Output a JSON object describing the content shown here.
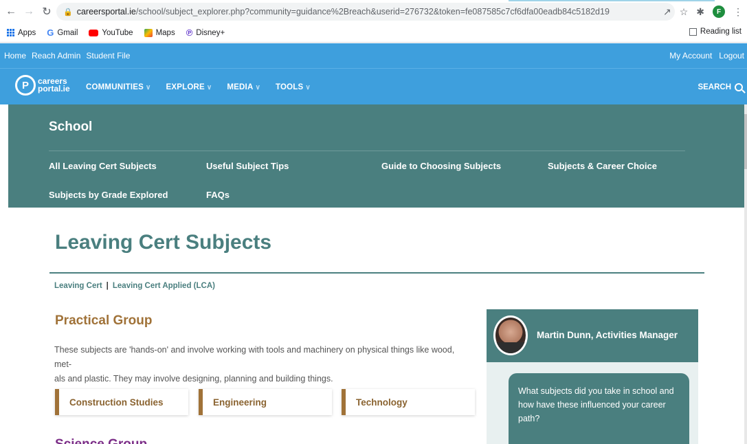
{
  "browser": {
    "url_host": "careersportal.ie",
    "url_path": "/school/subject_explorer.php?community=guidance%2Breach&userid=276732&token=fe087585c7cf6dfa00eadb84c5182d19",
    "profile_initial": "F",
    "bookmarks": [
      {
        "label": "Apps",
        "icon": "apps-grid-icon"
      },
      {
        "label": "Gmail",
        "icon": "google-g-icon"
      },
      {
        "label": "YouTube",
        "icon": "youtube-icon"
      },
      {
        "label": "Maps",
        "icon": "maps-icon"
      },
      {
        "label": "Disney+",
        "icon": "disney-plus-icon"
      }
    ],
    "reading_list": "Reading list"
  },
  "admin_bar": {
    "links": [
      "Home",
      "Reach Admin",
      "Student File"
    ],
    "my_account": "My Account",
    "logout": "Logout"
  },
  "main_nav": {
    "logo_line1": "careers",
    "logo_line2": "portal.ie",
    "menu": [
      "COMMUNITIES",
      "EXPLORE",
      "MEDIA",
      "TOOLS"
    ],
    "search": "SEARCH"
  },
  "school_panel": {
    "title": "School",
    "links": [
      "All Leaving Cert Subjects",
      "Useful Subject Tips",
      "Guide to Choosing Subjects",
      "Subjects & Career Choice",
      "Subjects by Grade Explored",
      "FAQs"
    ]
  },
  "content": {
    "page_title": "Leaving Cert Subjects",
    "subnav": [
      "Leaving Cert",
      "Leaving Cert Applied (LCA)"
    ],
    "subnav_sep": "|",
    "group_title": "Practical Group",
    "group_desc_line1": "These subjects are 'hands-on' and involve working with tools and machinery on physical things like wood, met-",
    "group_desc_line2": "als and plastic. They may involve designing, planning and building things.",
    "subjects": [
      "Construction Studies",
      "Engineering",
      "Technology"
    ],
    "next_group_partial": "Science Group"
  },
  "sidebar": {
    "profile_name": "Martin Dunn, Activities Manager",
    "question": "What subjects did you take in school and how have these influenced your career path?"
  },
  "colors": {
    "site_blue": "#3e9fdd",
    "teal": "#4a7f7f",
    "gold": "#a07238"
  }
}
